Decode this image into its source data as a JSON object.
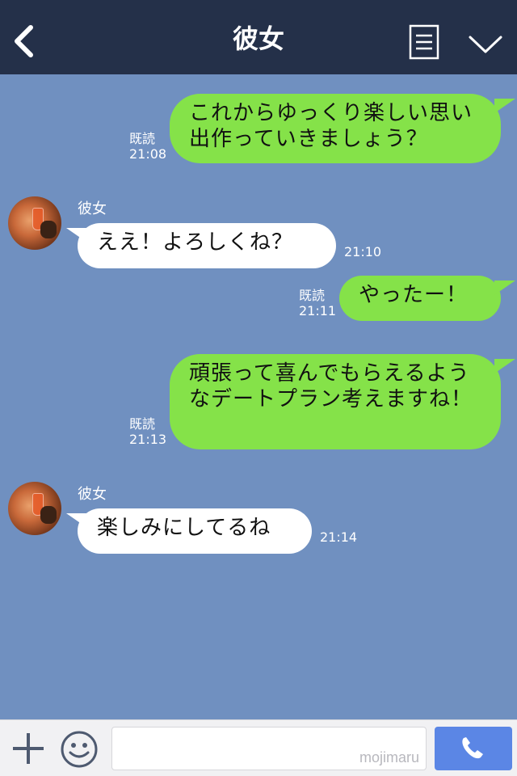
{
  "header": {
    "title": "彼女",
    "back_icon": "chevron-left-icon",
    "menu_icon": "note-list-icon",
    "dropdown_icon": "chevron-down-icon",
    "background": "#243049"
  },
  "chat": {
    "background": "#7090c0",
    "sent_bubble_color": "#85e249",
    "received_bubble_color": "#ffffff",
    "messages": [
      {
        "direction": "sent",
        "text": "これからゆっくり楽しい思い出作っていきましょう？",
        "read_label": "既読",
        "time": "21:08"
      },
      {
        "direction": "received",
        "sender": "彼女",
        "text": "ええ！よろしくね？",
        "time": "21:10"
      },
      {
        "direction": "sent",
        "text": "やったー！",
        "read_label": "既読",
        "time": "21:11"
      },
      {
        "direction": "sent",
        "text": "頑張って喜んでもらえるようなデートプラン考えますね！",
        "read_label": "既読",
        "time": "21:13"
      },
      {
        "direction": "received",
        "sender": "彼女",
        "text": "楽しみにしてるね",
        "time": "21:14"
      }
    ]
  },
  "input_bar": {
    "plus_icon": "plus-icon",
    "emoji_icon": "smiley-icon",
    "watermark": "mojimaru",
    "call_icon": "phone-icon",
    "call_button_color": "#5b86e5"
  }
}
